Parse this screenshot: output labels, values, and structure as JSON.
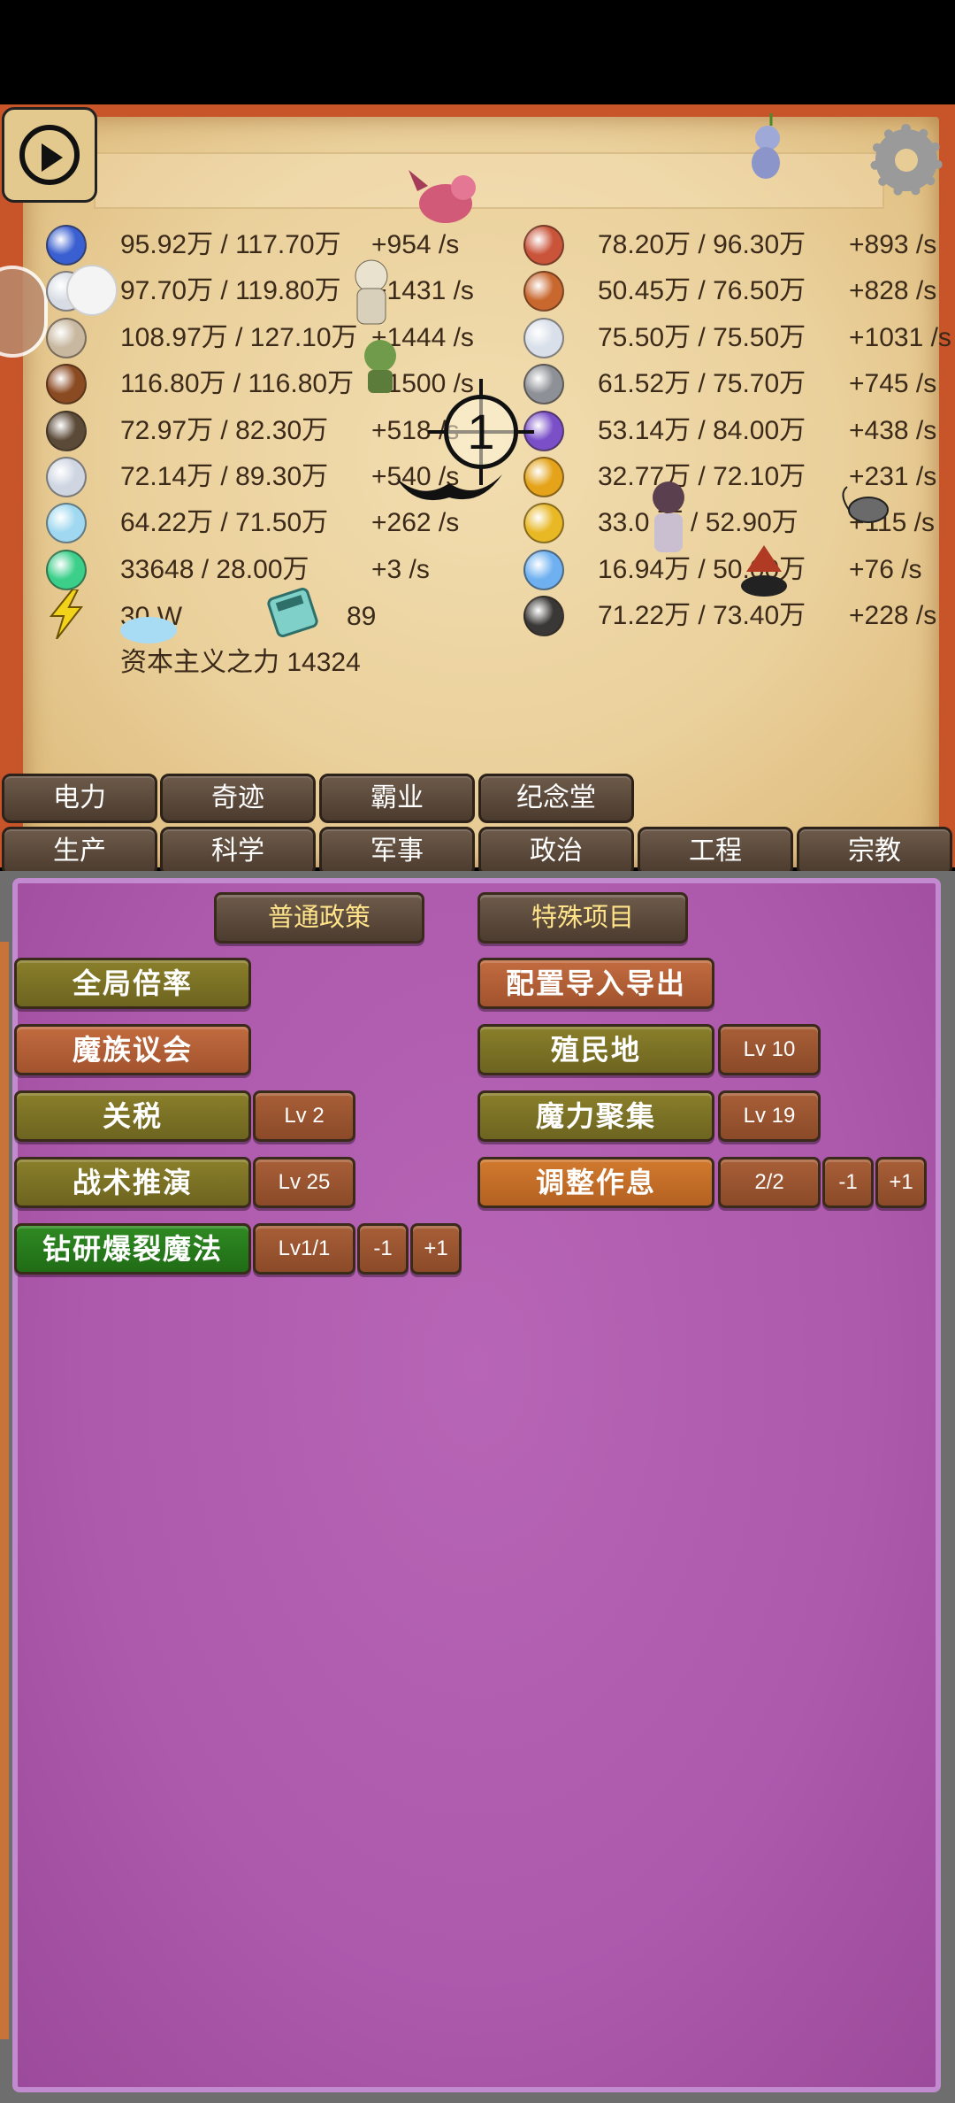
{
  "resources_left": [
    {
      "icon": "wizard-hat-icon",
      "color": "#3a5fd0",
      "amount": "95.92万 / 117.70万",
      "rate": "+954 /s"
    },
    {
      "icon": "sword-icon",
      "color": "#d8dde5",
      "amount": "97.70万 / 119.80万",
      "rate": "+1431 /s"
    },
    {
      "icon": "wand-icon",
      "color": "#c8b8a0",
      "amount": "108.97万 / 127.10万",
      "rate": "+1444 /s"
    },
    {
      "icon": "book-icon",
      "color": "#8a4a22",
      "amount": "116.80万 / 116.80万",
      "rate": "+1500 /s"
    },
    {
      "icon": "pickaxe-icon",
      "color": "#5b4a38",
      "amount": "72.97万 / 82.30万",
      "rate": "+518 /s"
    },
    {
      "icon": "winged-helmet-icon",
      "color": "#cfd6e2",
      "amount": "72.14万 / 89.30万",
      "rate": "+540 /s"
    },
    {
      "icon": "feather-icon",
      "color": "#9fd8f0",
      "amount": "64.22万 / 71.50万",
      "rate": "+262 /s"
    },
    {
      "icon": "mana-orb-icon",
      "color": "#3ccf8a",
      "amount": "33648 / 28.00万",
      "rate": "+3 /s"
    }
  ],
  "resources_right": [
    {
      "icon": "meat-icon",
      "color": "#c9543a",
      "amount": "78.20万 / 96.30万",
      "rate": "+893 /s"
    },
    {
      "icon": "wood-log-icon",
      "color": "#c8672e",
      "amount": "50.45万 / 76.50万",
      "rate": "+828 /s"
    },
    {
      "icon": "crystal-icon",
      "color": "#d9e0ea",
      "amount": "75.50万 / 75.50万",
      "rate": "+1031 /s"
    },
    {
      "icon": "iron-ingot-icon",
      "color": "#8d9096",
      "amount": "61.52万 / 75.70万",
      "rate": "+745 /s"
    },
    {
      "icon": "amethyst-icon",
      "color": "#7a4fc8",
      "amount": "53.14万 / 84.00万",
      "rate": "+438 /s"
    },
    {
      "icon": "gold-coin-icon",
      "color": "#e4a318",
      "amount": "32.77万 / 72.10万",
      "rate": "+231 /s"
    },
    {
      "icon": "gold-bar-icon",
      "color": "#e8b825",
      "amount": "33.0 万 / 52.90万",
      "rate": "+115 /s"
    },
    {
      "icon": "diamond-icon",
      "color": "#6fb1f0",
      "amount": "16.94万 / 50.00万",
      "rate": "+76 /s"
    },
    {
      "icon": "coal-icon",
      "color": "#3a3836",
      "amount": "71.22万 / 73.40万",
      "rate": "+228 /s"
    }
  ],
  "power": {
    "icon": "lightning-icon",
    "value": "30 W"
  },
  "calculator": {
    "icon": "calculator-icon",
    "value": "89"
  },
  "capitalism": "资本主义之力 14324",
  "crosshair_number": "1",
  "tabs_top": [
    "电力",
    "奇迹",
    "霸业",
    "纪念堂"
  ],
  "tabs_bottom": [
    "生产",
    "科学",
    "军事",
    "政治",
    "工程",
    "宗教"
  ],
  "policy_tabs": [
    "普通政策",
    "特殊项目"
  ],
  "policies": {
    "global_rate": "全局倍率",
    "config_io": "配置导入导出",
    "demon_council": "魔族议会",
    "colony": "殖民地",
    "colony_lv": "Lv 10",
    "tariff": "关税",
    "tariff_lv": "Lv 2",
    "mana_gather": "魔力聚集",
    "mana_gather_lv": "Lv 19",
    "tactics": "战术推演",
    "tactics_lv": "Lv 25",
    "rest": "调整作息",
    "rest_lv": "2/2",
    "rest_minus": "-1",
    "rest_plus": "+1",
    "burst_magic": "钻研爆裂魔法",
    "burst_lv": "Lv1/1",
    "burst_minus": "-1",
    "burst_plus": "+1"
  }
}
